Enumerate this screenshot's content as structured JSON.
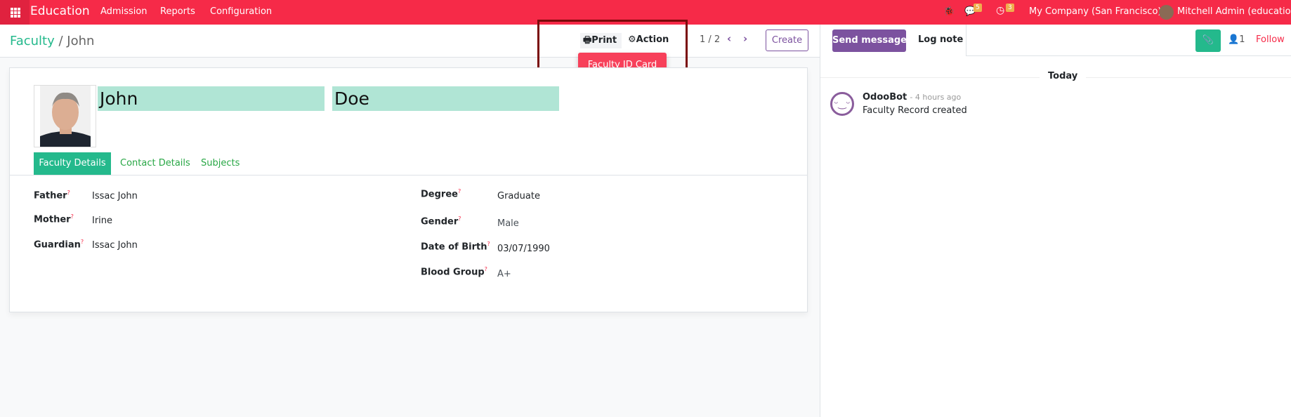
{
  "navbar": {
    "app": "Education",
    "menu": [
      "Admission",
      "Reports",
      "Configuration"
    ],
    "messages_count": "5",
    "activities_count": "3",
    "company": "My Company (San Francisco)",
    "user": "Mitchell Admin (education)",
    "color": "#f62a48"
  },
  "breadcrumb": {
    "parent": "Faculty",
    "separator": "/",
    "current": "John"
  },
  "toolbar": {
    "print": "Print",
    "action": "Action",
    "pager": "1 / 2",
    "create": "Create",
    "print_menu": [
      "Faculty ID Card"
    ]
  },
  "record": {
    "first_name": "John",
    "last_name": "Doe",
    "tabs": [
      "Faculty Details",
      "Contact Details",
      "Subjects"
    ],
    "active_tab": "Faculty Details",
    "left_fields": [
      {
        "label": "Father",
        "value": "Issac John"
      },
      {
        "label": "Mother",
        "value": "Irine"
      },
      {
        "label": "Guardian",
        "value": "Issac John"
      }
    ],
    "right_fields": [
      {
        "label": "Degree",
        "value": "Graduate"
      },
      {
        "label": "Gender",
        "value": "Male"
      },
      {
        "label": "Date of Birth",
        "value": "03/07/1990"
      },
      {
        "label": "Blood Group",
        "value": "A+"
      }
    ],
    "help_mark": "?"
  },
  "chatter": {
    "send_message": "Send message",
    "log_note": "Log note",
    "followers": "1",
    "follow": "Follow",
    "date_sep": "Today",
    "messages": [
      {
        "author": "OdooBot",
        "time": "- 4 hours ago",
        "body": "Faculty Record created"
      }
    ]
  }
}
